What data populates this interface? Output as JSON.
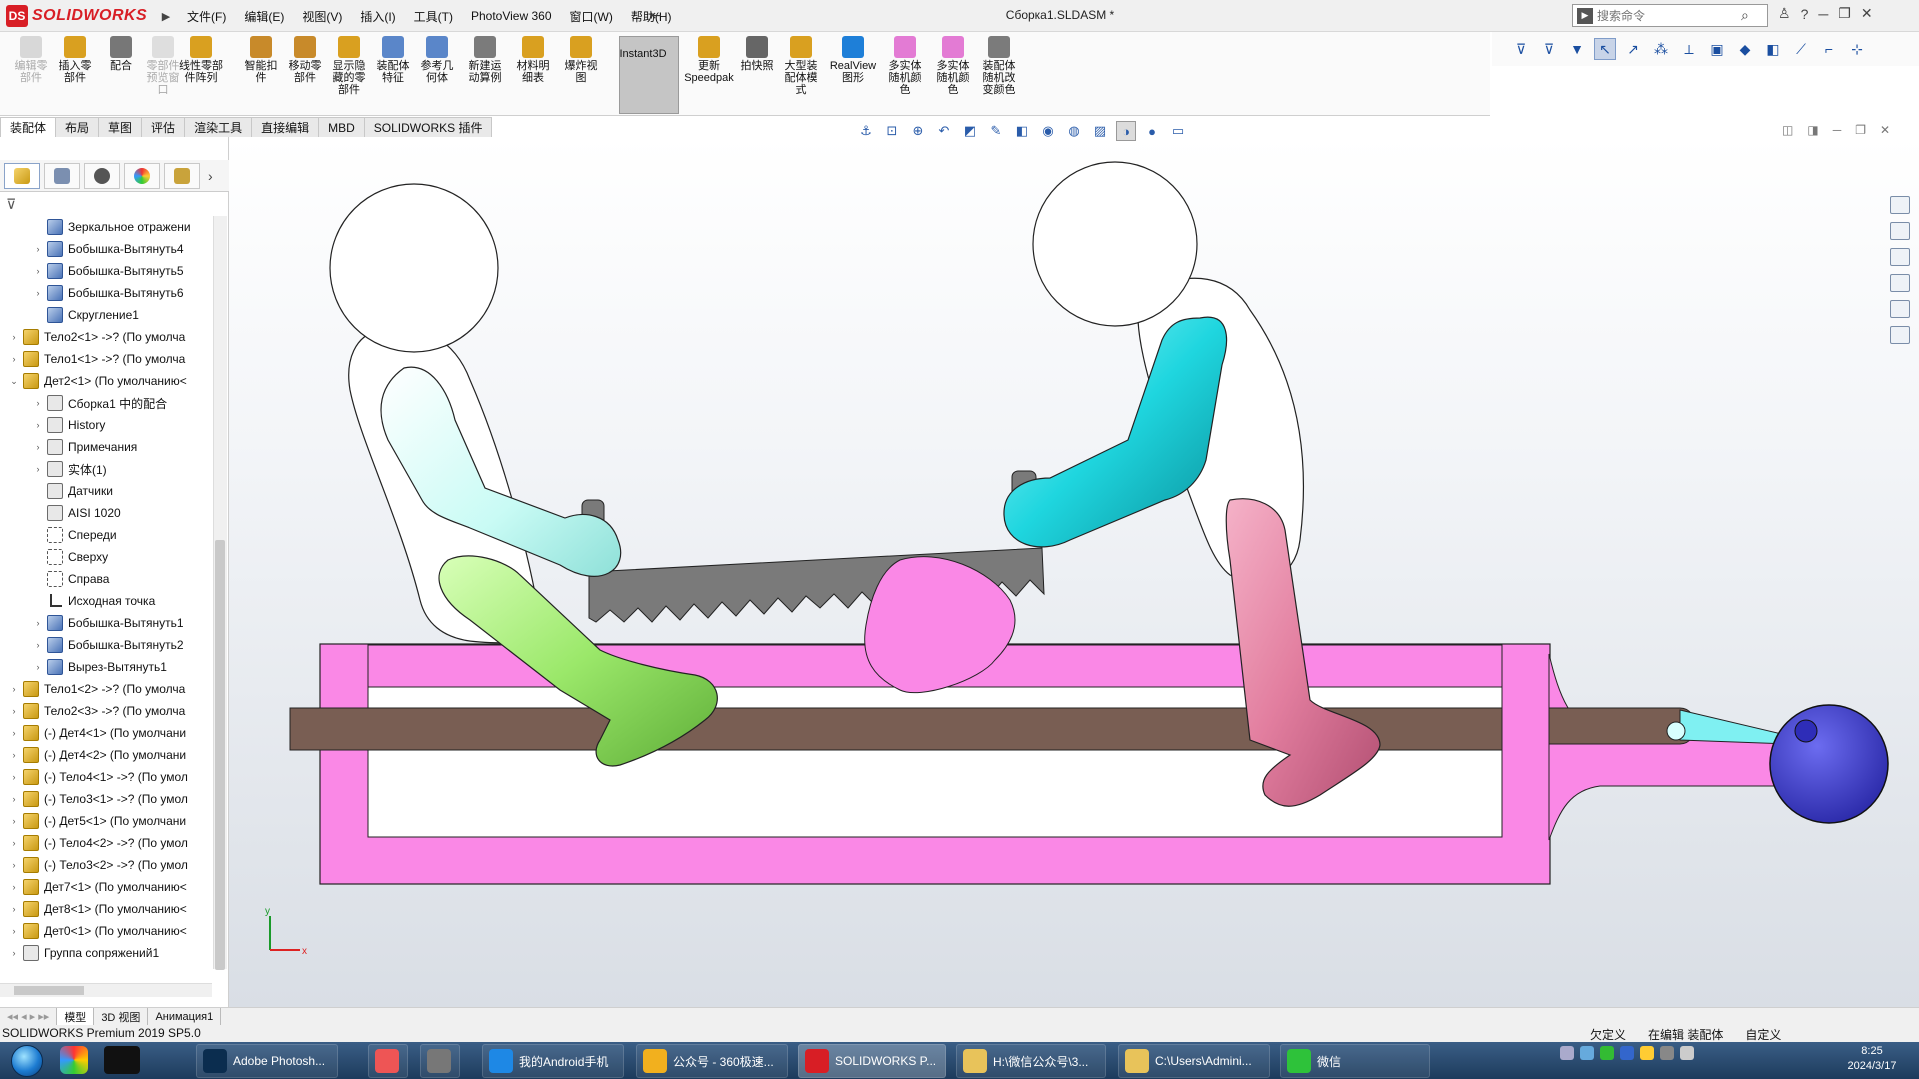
{
  "app": {
    "brand": "SOLIDWORKS",
    "logo_mark": "DS",
    "document_title": "Сборка1.SLDASM *"
  },
  "menu": [
    "文件(F)",
    "编辑(E)",
    "视图(V)",
    "插入(I)",
    "工具(T)",
    "PhotoView 360",
    "窗口(W)",
    "帮助(H)"
  ],
  "search": {
    "placeholder": "搜索命令"
  },
  "title_icons": [
    "user-icon",
    "help-icon",
    "minimize-icon",
    "restore-icon",
    "close-icon"
  ],
  "commands": [
    {
      "label": "编辑零\n部件",
      "enabled": false
    },
    {
      "label": "插入零\n部件",
      "enabled": true
    },
    {
      "label": "配合",
      "enabled": true
    },
    {
      "label": "零部件\n预览窗\n口",
      "enabled": false
    },
    {
      "label": "线性零部\n件阵列",
      "enabled": true
    },
    {
      "label": "智能扣\n件",
      "enabled": true
    },
    {
      "label": "移动零\n部件",
      "enabled": true
    },
    {
      "label": "显示隐\n藏的零\n部件",
      "enabled": true
    },
    {
      "label": "装配体\n特征",
      "enabled": true
    },
    {
      "label": "参考几\n何体",
      "enabled": true
    },
    {
      "label": "新建运\n动算例",
      "enabled": true
    },
    {
      "label": "材料明\n细表",
      "enabled": true
    },
    {
      "label": "爆炸视\n图",
      "enabled": true
    },
    {
      "label": "Instant3D",
      "enabled": true
    },
    {
      "label": "更新\nSpeedpak",
      "enabled": true
    },
    {
      "label": "拍快照",
      "enabled": true
    },
    {
      "label": "大型装\n配体模\n式",
      "enabled": true
    },
    {
      "label": "RealView\n图形",
      "enabled": true
    },
    {
      "label": "多实体\n随机颜\n色",
      "enabled": true
    },
    {
      "label": "多实体\n随机颜\n色",
      "enabled": true
    },
    {
      "label": "装配体\n随机改\n变颜色",
      "enabled": true
    }
  ],
  "tabs": [
    "装配体",
    "布局",
    "草图",
    "评估",
    "渲染工具",
    "直接编辑",
    "MBD",
    "SOLIDWORKS 插件"
  ],
  "active_tab": "装配体",
  "tree": [
    {
      "label": "Зеркальное отражени",
      "indent": 2,
      "expand": "",
      "icon": "feat"
    },
    {
      "label": "Бобышка-Вытянуть4",
      "indent": 2,
      "expand": "›",
      "icon": "feat"
    },
    {
      "label": "Бобышка-Вытянуть5",
      "indent": 2,
      "expand": "›",
      "icon": "feat"
    },
    {
      "label": "Бобышка-Вытянуть6",
      "indent": 2,
      "expand": "›",
      "icon": "feat"
    },
    {
      "label": "Скругление1",
      "indent": 2,
      "expand": "",
      "icon": "feat"
    },
    {
      "label": "Тело2<1> ->? (По умолча",
      "indent": 1,
      "expand": "›",
      "icon": "part"
    },
    {
      "label": "Тело1<1> ->? (По умолча",
      "indent": 1,
      "expand": "›",
      "icon": "part"
    },
    {
      "label": "Дет2<1> (По умолчанию<",
      "indent": 1,
      "expand": "⌄",
      "icon": "part"
    },
    {
      "label": "Сборка1 中的配合",
      "indent": 2,
      "expand": "›",
      "icon": "folder"
    },
    {
      "label": "History",
      "indent": 2,
      "expand": "›",
      "icon": "folder"
    },
    {
      "label": "Примечания",
      "indent": 2,
      "expand": "›",
      "icon": "folder"
    },
    {
      "label": "实体(1)",
      "indent": 2,
      "expand": "›",
      "icon": "folder"
    },
    {
      "label": "Датчики",
      "indent": 2,
      "expand": "",
      "icon": "folder"
    },
    {
      "label": "AISI 1020",
      "indent": 2,
      "expand": "",
      "icon": "folder"
    },
    {
      "label": "Спереди",
      "indent": 2,
      "expand": "",
      "icon": "plane"
    },
    {
      "label": "Сверху",
      "indent": 2,
      "expand": "",
      "icon": "plane"
    },
    {
      "label": "Справа",
      "indent": 2,
      "expand": "",
      "icon": "plane"
    },
    {
      "label": "Исходная точка",
      "indent": 2,
      "expand": "",
      "icon": "origin"
    },
    {
      "label": "Бобышка-Вытянуть1",
      "indent": 2,
      "expand": "›",
      "icon": "feat"
    },
    {
      "label": "Бобышка-Вытянуть2",
      "indent": 2,
      "expand": "›",
      "icon": "feat"
    },
    {
      "label": "Вырез-Вытянуть1",
      "indent": 2,
      "expand": "›",
      "icon": "feat"
    },
    {
      "label": "Тело1<2> ->? (По умолча",
      "indent": 1,
      "expand": "›",
      "icon": "part"
    },
    {
      "label": "Тело2<3> ->? (По умолча",
      "indent": 1,
      "expand": "›",
      "icon": "part"
    },
    {
      "label": "(-) Дет4<1> (По умолчани",
      "indent": 1,
      "expand": "›",
      "icon": "part"
    },
    {
      "label": "(-) Дет4<2> (По умолчани",
      "indent": 1,
      "expand": "›",
      "icon": "part"
    },
    {
      "label": "(-) Тело4<1> ->? (По умол",
      "indent": 1,
      "expand": "›",
      "icon": "part"
    },
    {
      "label": "(-) Тело3<1> ->? (По умол",
      "indent": 1,
      "expand": "›",
      "icon": "part"
    },
    {
      "label": "(-) Дет5<1> (По умолчани",
      "indent": 1,
      "expand": "›",
      "icon": "part"
    },
    {
      "label": "(-) Тело4<2> ->? (По умол",
      "indent": 1,
      "expand": "›",
      "icon": "part"
    },
    {
      "label": "(-) Тело3<2> ->? (По умол",
      "indent": 1,
      "expand": "›",
      "icon": "part"
    },
    {
      "label": "Дет7<1> (По умолчанию<",
      "indent": 1,
      "expand": "›",
      "icon": "part"
    },
    {
      "label": "Дет8<1> (По умолчанию<",
      "indent": 1,
      "expand": "›",
      "icon": "part"
    },
    {
      "label": "Дет0<1> (По умолчанию<",
      "indent": 1,
      "expand": "›",
      "icon": "part"
    },
    {
      "label": "Группа сопряжений1",
      "indent": 1,
      "expand": "›",
      "icon": "folder"
    }
  ],
  "model_tabs": [
    "模型",
    "3D 视图",
    "Анимация1"
  ],
  "active_model_tab": "模型",
  "status": {
    "left": "SOLIDWORKS Premium 2019 SP5.0",
    "items": [
      "欠定义",
      "在编辑 装配体",
      "自定义"
    ]
  },
  "taskbar": [
    {
      "label": "Adobe Photosh...",
      "color": "#0b2d4f"
    },
    {
      "label": "我的Android手机",
      "color": "#1e88e5"
    },
    {
      "label": "公众号 - 360极速...",
      "color": "#f2b01e"
    },
    {
      "label": "SOLIDWORKS P...",
      "color": "#d81e25"
    },
    {
      "label": "H:\\微信公众号\\3...",
      "color": "#e8c35a"
    },
    {
      "label": "C:\\Users\\Admini...",
      "color": "#e8c35a"
    },
    {
      "label": "微信",
      "color": "#2ec23a"
    }
  ],
  "clock": {
    "time": "8:25",
    "date": "2024/3/17"
  },
  "triad": {
    "x": "x",
    "y": "y"
  },
  "colors": {
    "pink": "#fa88e6",
    "brown": "#795e53",
    "cyan": "#1fd6df",
    "green": "#9be86a",
    "rose": "#e27e9f",
    "lightcyan": "#c9fbf5",
    "blue": "#3c3bd1"
  }
}
